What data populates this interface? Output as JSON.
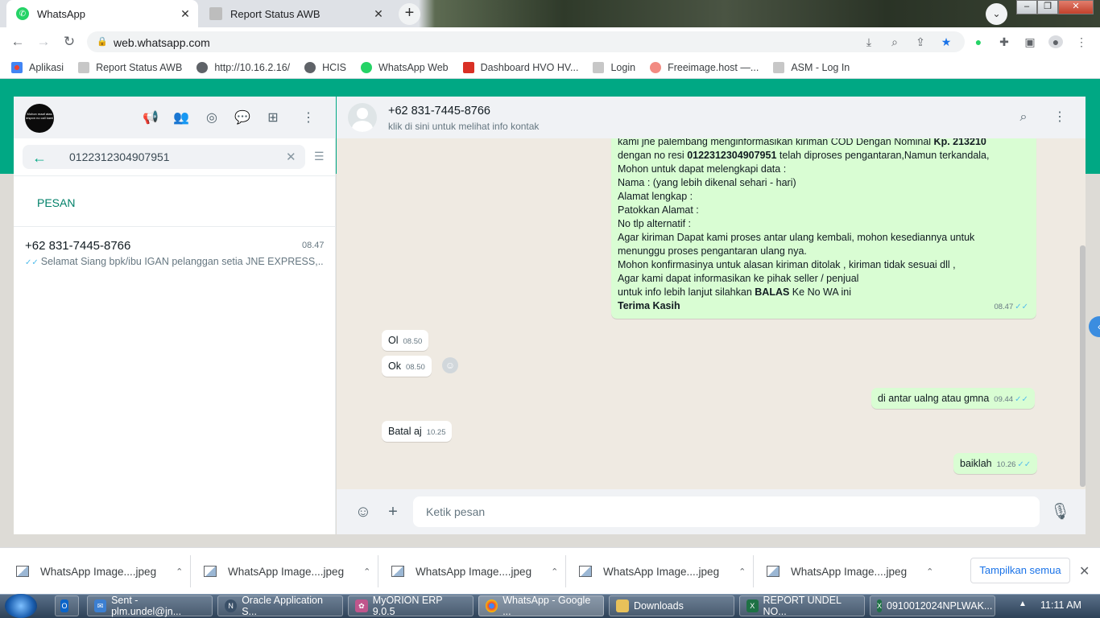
{
  "browser": {
    "tabs": [
      {
        "title": "WhatsApp",
        "icon": "whatsapp-icon",
        "active": true
      },
      {
        "title": "Report Status AWB",
        "icon": "page-icon",
        "active": false
      }
    ],
    "url": "web.whatsapp.com",
    "bookmarks": [
      {
        "label": "Aplikasi",
        "icon": "apps-grid-icon"
      },
      {
        "label": "Report Status AWB",
        "icon": "page-icon"
      },
      {
        "label": "http://10.16.2.16/",
        "icon": "globe-icon"
      },
      {
        "label": "HCIS",
        "icon": "globe-icon"
      },
      {
        "label": "WhatsApp Web",
        "icon": "whatsapp-icon"
      },
      {
        "label": "Dashboard HVO HV...",
        "icon": "dashboard-icon"
      },
      {
        "label": "Login",
        "icon": "page-icon"
      },
      {
        "label": "Freeimage.host —...",
        "icon": "freeimage-icon"
      },
      {
        "label": "ASM - Log In",
        "icon": "page-icon"
      }
    ]
  },
  "sidebar": {
    "avatar_text": "Mohon maaf atas respon no call kami",
    "search_value": "0122312304907951",
    "section_label": "PESAN",
    "result": {
      "name": "+62 831-7445-8766",
      "time": "08.47",
      "preview": "Selamat Siang   bpk/ibu IGAN pelanggan setia JNE EXPRESS,..."
    }
  },
  "conversation": {
    "contact_name": "+62 831-7445-8766",
    "contact_sub": "klik di sini untuk melihat info kontak",
    "big_message": {
      "line1_pre": "kami jne palembang menginformasikan kiriman  COD Dengan Nominal ",
      "line1_bold": "Kp. 213210",
      "line2_pre": "dengan no resi ",
      "line2_bold": "0122312304907951",
      "line2_post": " telah diproses pengantaran,Namun terkandala,",
      "lines": [
        "Mohon untuk dapat melengkapi data :",
        "Nama : (yang lebih dikenal sehari - hari)",
        "Alamat  lengkap :",
        "Patokkan Alamat :",
        "No tlp alternatif :",
        "Agar kiriman Dapat kami proses antar ulang kembali, mohon kesediannya untuk",
        "menunggu proses pengantaran ulang nya.",
        "Mohon konfirmasinya untuk alasan kiriman ditolak , kiriman tidak sesuai dll ,",
        "Agar kami dapat informasikan ke pihak seller / penjual"
      ],
      "last_pre": "untuk info lebih lanjut silahkan ",
      "last_bold": "BALAS",
      "last_post": " Ke No WA ini",
      "closing": "Terima Kasih",
      "time": "08.47"
    },
    "messages": [
      {
        "text": "Ol",
        "time": "08.50",
        "dir": "in"
      },
      {
        "text": "Ok",
        "time": "08.50",
        "dir": "in"
      },
      {
        "text": "di antar ualng atau gmna",
        "time": "09.44",
        "dir": "out"
      },
      {
        "text": "Batal aj",
        "time": "10.25",
        "dir": "in"
      },
      {
        "text": "baiklah",
        "time": "10.26",
        "dir": "out"
      }
    ],
    "input_placeholder": "Ketik pesan"
  },
  "downloads": {
    "items": [
      "WhatsApp Image....jpeg",
      "WhatsApp Image....jpeg",
      "WhatsApp Image....jpeg",
      "WhatsApp Image....jpeg",
      "WhatsApp Image....jpeg"
    ],
    "show_all": "Tampilkan semua"
  },
  "taskbar": {
    "items": [
      {
        "label": "Sent - plm.undel@jn...",
        "icon": "outlook-icon"
      },
      {
        "label": "Oracle Application S...",
        "icon": "oracle-icon"
      },
      {
        "label": "MyORION ERP 9.0.5",
        "icon": "erp-icon"
      },
      {
        "label": "WhatsApp - Google ...",
        "icon": "chrome-icon"
      },
      {
        "label": "Downloads",
        "icon": "folder-icon"
      },
      {
        "label": "REPORT UNDEL NO...",
        "icon": "excel-icon"
      },
      {
        "label": "0910012024NPLWAK...",
        "icon": "excel-icon"
      }
    ],
    "clock": "11:11 AM"
  },
  "colors": {
    "wa_green": "#00a884",
    "out_bubble": "#d9fdd3",
    "tick_blue": "#53bdeb"
  }
}
